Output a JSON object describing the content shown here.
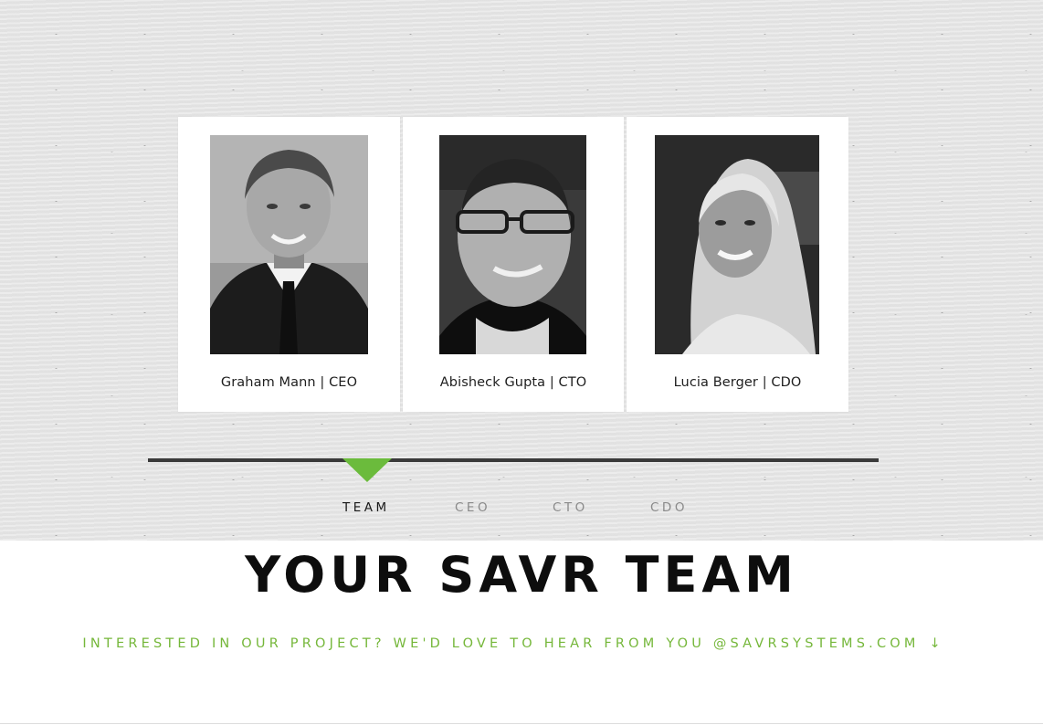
{
  "team": {
    "members": [
      {
        "name": "Graham Mann | CEO"
      },
      {
        "name": "Abisheck Gupta | CTO"
      },
      {
        "name": "Lucia Berger | CDO"
      }
    ]
  },
  "timeline": {
    "items": [
      {
        "label": "TEAM",
        "active": true
      },
      {
        "label": "CEO",
        "active": false
      },
      {
        "label": "CTO",
        "active": false
      },
      {
        "label": "CDO",
        "active": false
      }
    ],
    "accent_color": "#6bbb3c"
  },
  "section": {
    "title": "YOUR SAVR TEAM",
    "contact_text": "INTERESTED IN OUR PROJECT? WE'D LOVE TO HEAR FROM YOU @SAVRSYSTEMS.COM",
    "contact_icon": "down-arrow-icon",
    "contact_color": "#75b73a"
  }
}
